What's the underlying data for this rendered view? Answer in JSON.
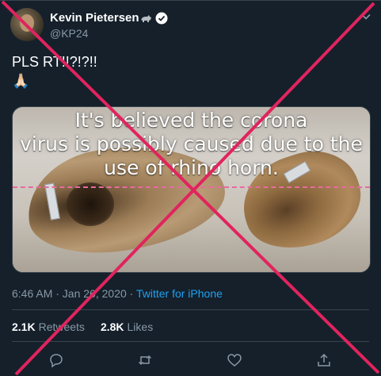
{
  "author": {
    "name": "Kevin Pietersen",
    "handle": "@KP24"
  },
  "tweet": {
    "text_line1": "PLS RT!!?!?!!",
    "text_line2": "🙏🏻"
  },
  "media": {
    "overlay_line1": "It's believed the corona",
    "overlay_line2": "virus is possibly caused due to the",
    "overlay_line3": "use of rhino horn."
  },
  "meta": {
    "time": "6:46 AM · Jan 26, 2020 · ",
    "source": "Twitter for iPhone"
  },
  "stats": {
    "retweets_count": "2.1K",
    "retweets_label": "Retweets",
    "likes_count": "2.8K",
    "likes_label": "Likes"
  },
  "colors": {
    "background": "#15202b",
    "accent": "#1da1f2",
    "muted": "#8899a6",
    "cross": "#e0245e"
  },
  "icons": [
    "rhino-icon",
    "verified-icon",
    "chevron-down-icon",
    "reply-icon",
    "retweet-icon",
    "like-icon",
    "share-icon"
  ]
}
